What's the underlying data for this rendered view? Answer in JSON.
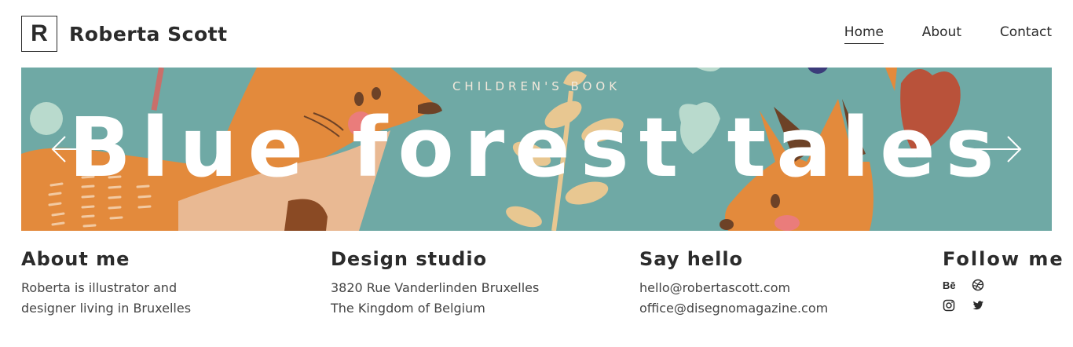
{
  "header": {
    "logo_letter": "R",
    "site_name": "Roberta Scott",
    "nav": {
      "home": "Home",
      "about": "About",
      "contact": "Contact"
    }
  },
  "hero": {
    "eyebrow": "CHILDREN'S BOOK",
    "title": "Blue forest tales",
    "colors": {
      "background": "#6fa9a5",
      "fox_orange": "#e38a3c",
      "leaf_beige": "#e8c791",
      "heart_red": "#b9523a"
    }
  },
  "footer": {
    "about": {
      "heading": "About me",
      "line1": "Roberta is illustrator and",
      "line2": "designer living in Bruxelles"
    },
    "studio": {
      "heading": "Design studio",
      "line1": "3820 Rue Vanderlinden Bruxelles",
      "line2": "The Kingdom of Belgium"
    },
    "hello": {
      "heading": "Say hello",
      "email1": "hello@robertascott.com",
      "email2": "office@disegnomagazine.com"
    },
    "follow": {
      "heading": "Follow me",
      "icons": [
        "behance-icon",
        "dribbble-icon",
        "instagram-icon",
        "twitter-icon"
      ]
    }
  }
}
